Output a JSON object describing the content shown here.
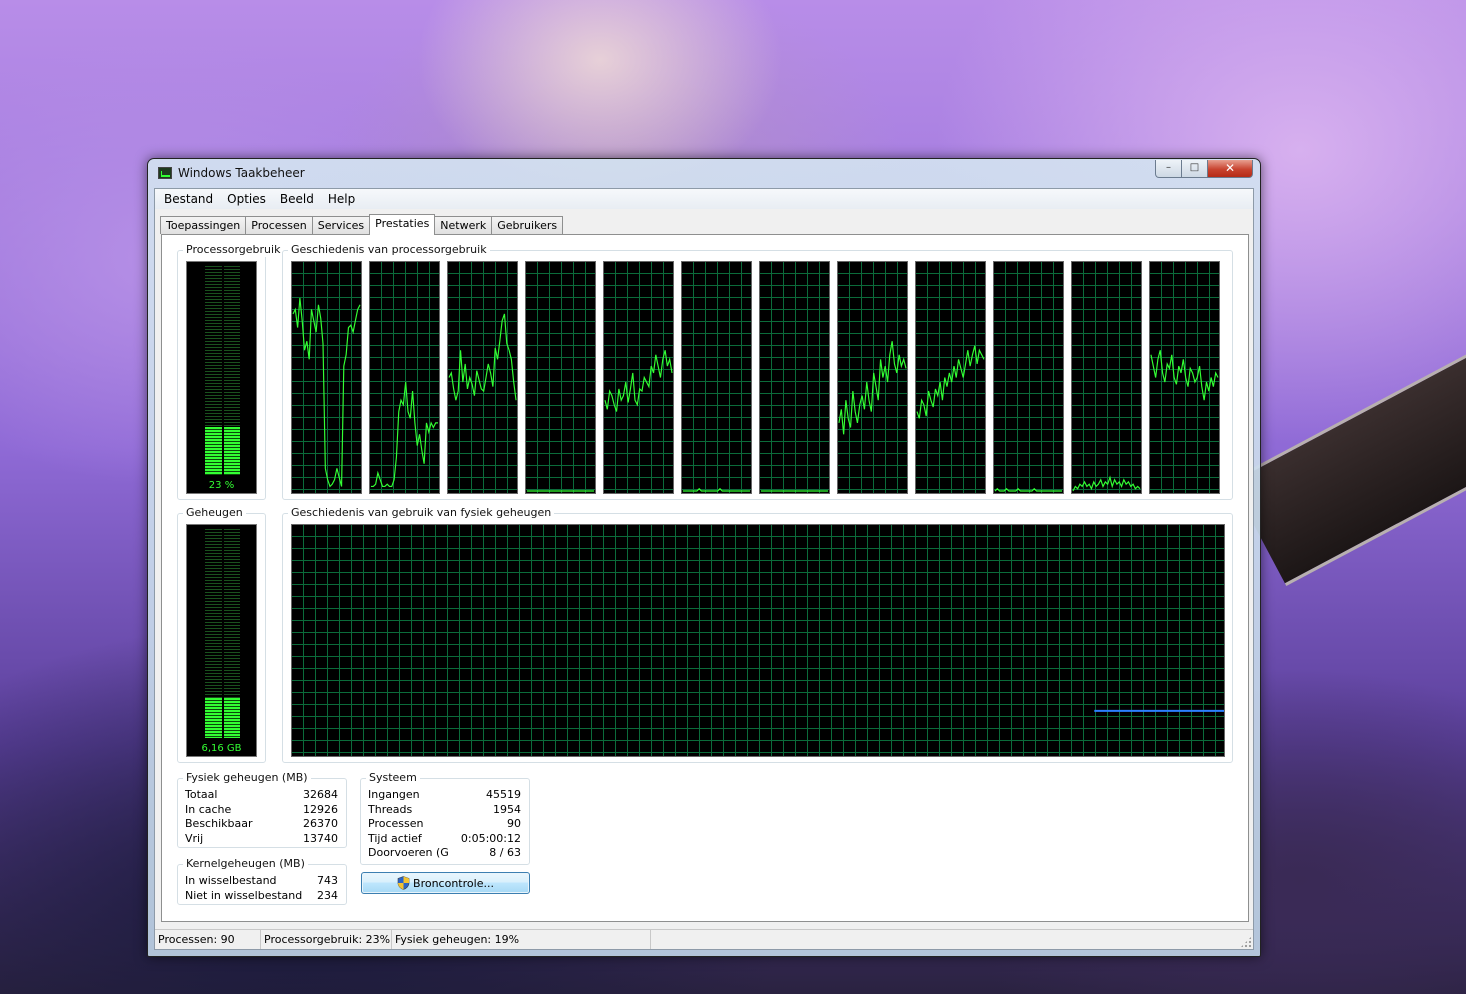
{
  "window": {
    "title": "Windows Taakbeheer",
    "caption": {
      "minimize": "–",
      "maximize": "□",
      "close": "✕"
    }
  },
  "menu": [
    "Bestand",
    "Opties",
    "Beeld",
    "Help"
  ],
  "tabs": [
    "Toepassingen",
    "Processen",
    "Services",
    "Prestaties",
    "Netwerk",
    "Gebruikers"
  ],
  "active_tab": "Prestaties",
  "performance": {
    "cpu": {
      "label": "Processorgebruik",
      "value_label": "23 %",
      "level_fraction": 0.23,
      "history_label": "Geschiedenis van processorgebruik",
      "core_levels": [
        [
          0.78,
          0.8,
          0.72,
          0.85,
          0.75,
          0.62,
          0.66,
          0.58,
          0.8,
          0.75,
          0.7,
          0.82,
          0.76,
          0.65,
          0.1,
          0.05,
          0.02,
          0.03,
          0.05,
          0.1,
          0.06,
          0.02,
          0.55,
          0.6,
          0.72,
          0.73,
          0.7,
          0.75,
          0.8,
          0.82
        ],
        [
          0.02,
          0.02,
          0.03,
          0.08,
          0.05,
          0.02,
          0.02,
          0.03,
          0.02,
          0.02,
          0.05,
          0.15,
          0.35,
          0.4,
          0.38,
          0.48,
          0.35,
          0.32,
          0.44,
          0.3,
          0.2,
          0.25,
          0.18,
          0.12,
          0.3,
          0.26,
          0.3,
          0.28,
          0.3,
          0.3
        ],
        [
          0.5,
          0.52,
          0.45,
          0.4,
          0.44,
          0.62,
          0.48,
          0.56,
          0.45,
          0.5,
          0.47,
          0.42,
          0.53,
          0.49,
          0.45,
          0.44,
          0.5,
          0.56,
          0.52,
          0.46,
          0.63,
          0.58,
          0.66,
          0.75,
          0.78,
          0.65,
          0.62,
          0.58,
          0.48,
          0.4
        ],
        [
          0.0,
          0.0,
          0.0,
          0.0,
          0.0,
          0.0,
          0.0,
          0.0,
          0.0,
          0.0,
          0.0,
          0.0,
          0.0,
          0.0,
          0.0,
          0.0,
          0.0,
          0.0,
          0.0,
          0.0,
          0.0,
          0.0,
          0.0,
          0.0,
          0.0,
          0.0,
          0.0,
          0.0,
          0.0,
          0.0
        ],
        [
          0.4,
          0.36,
          0.44,
          0.42,
          0.38,
          0.35,
          0.45,
          0.4,
          0.42,
          0.48,
          0.39,
          0.45,
          0.52,
          0.4,
          0.38,
          0.45,
          0.44,
          0.5,
          0.48,
          0.46,
          0.55,
          0.52,
          0.6,
          0.55,
          0.5,
          0.58,
          0.62,
          0.55,
          0.58,
          0.52
        ],
        [
          0.0,
          0.0,
          0.0,
          0.0,
          0.0,
          0.0,
          0.0,
          0.01,
          0.0,
          0.0,
          0.0,
          0.0,
          0.0,
          0.0,
          0.0,
          0.0,
          0.01,
          0.0,
          0.0,
          0.0,
          0.0,
          0.0,
          0.0,
          0.0,
          0.0,
          0.0,
          0.0,
          0.0,
          0.0,
          0.0
        ],
        [
          0.0,
          0.0,
          0.0,
          0.0,
          0.0,
          0.0,
          0.0,
          0.0,
          0.0,
          0.0,
          0.0,
          0.0,
          0.0,
          0.0,
          0.0,
          0.0,
          0.0,
          0.0,
          0.0,
          0.0,
          0.0,
          0.0,
          0.0,
          0.0,
          0.0,
          0.0,
          0.0,
          0.0,
          0.0,
          0.0
        ],
        [
          0.3,
          0.36,
          0.25,
          0.4,
          0.32,
          0.28,
          0.44,
          0.35,
          0.3,
          0.38,
          0.42,
          0.36,
          0.48,
          0.4,
          0.35,
          0.52,
          0.46,
          0.4,
          0.58,
          0.5,
          0.55,
          0.48,
          0.6,
          0.66,
          0.56,
          0.52,
          0.6,
          0.55,
          0.58,
          0.54
        ],
        [
          0.35,
          0.32,
          0.4,
          0.38,
          0.33,
          0.44,
          0.4,
          0.37,
          0.45,
          0.42,
          0.48,
          0.4,
          0.5,
          0.46,
          0.52,
          0.48,
          0.55,
          0.5,
          0.58,
          0.54,
          0.5,
          0.56,
          0.62,
          0.55,
          0.6,
          0.64,
          0.56,
          0.62,
          0.6,
          0.58
        ],
        [
          0.0,
          0.01,
          0.0,
          0.0,
          0.0,
          0.01,
          0.0,
          0.0,
          0.0,
          0.0,
          0.01,
          0.0,
          0.0,
          0.0,
          0.0,
          0.0,
          0.0,
          0.01,
          0.0,
          0.0,
          0.0,
          0.0,
          0.0,
          0.0,
          0.0,
          0.0,
          0.0,
          0.0,
          0.0,
          0.0
        ],
        [
          0.0,
          0.02,
          0.01,
          0.03,
          0.02,
          0.04,
          0.02,
          0.03,
          0.01,
          0.04,
          0.02,
          0.03,
          0.05,
          0.02,
          0.04,
          0.03,
          0.06,
          0.02,
          0.05,
          0.03,
          0.04,
          0.02,
          0.05,
          0.03,
          0.04,
          0.02,
          0.03,
          0.01,
          0.02,
          0.01
        ],
        [
          0.6,
          0.55,
          0.5,
          0.58,
          0.62,
          0.52,
          0.48,
          0.56,
          0.54,
          0.6,
          0.5,
          0.47,
          0.55,
          0.52,
          0.58,
          0.5,
          0.46,
          0.54,
          0.52,
          0.48,
          0.5,
          0.55,
          0.46,
          0.4,
          0.48,
          0.44,
          0.5,
          0.46,
          0.52,
          0.5
        ]
      ]
    },
    "memory": {
      "label": "Geheugen",
      "value_label": "6,16 GB",
      "level_fraction": 0.19,
      "history_label": "Geschiedenis van gebruik van fysiek geheugen",
      "usage_fraction": 0.19
    }
  },
  "physical_memory": {
    "label": "Fysiek geheugen (MB)",
    "rows": [
      {
        "name": "Totaal",
        "value": "32684"
      },
      {
        "name": "In cache",
        "value": "12926"
      },
      {
        "name": "Beschikbaar",
        "value": "26370"
      },
      {
        "name": "Vrij",
        "value": "13740"
      }
    ]
  },
  "kernel_memory": {
    "label": "Kernelgeheugen (MB)",
    "rows": [
      {
        "name": "In wisselbestand",
        "value": "743"
      },
      {
        "name": "Niet in wisselbestand",
        "value": "234"
      }
    ]
  },
  "system": {
    "label": "Systeem",
    "rows": [
      {
        "name": "Ingangen",
        "value": "45519"
      },
      {
        "name": "Threads",
        "value": "1954"
      },
      {
        "name": "Processen",
        "value": "90"
      },
      {
        "name": "Tijd actief",
        "value": "0:05:00:12"
      },
      {
        "name": "Doorvoeren (G",
        "value": "8 / 63"
      }
    ]
  },
  "resource_button": "Broncontrole...",
  "statusbar": {
    "processes": "Processen: 90",
    "cpu": "Processorgebruik: 23%",
    "memory": "Fysiek geheugen: 19%"
  },
  "colors": {
    "graph_line": "#33ff33",
    "grid": "#0b6b3a",
    "memory_line": "#2b7fff"
  }
}
